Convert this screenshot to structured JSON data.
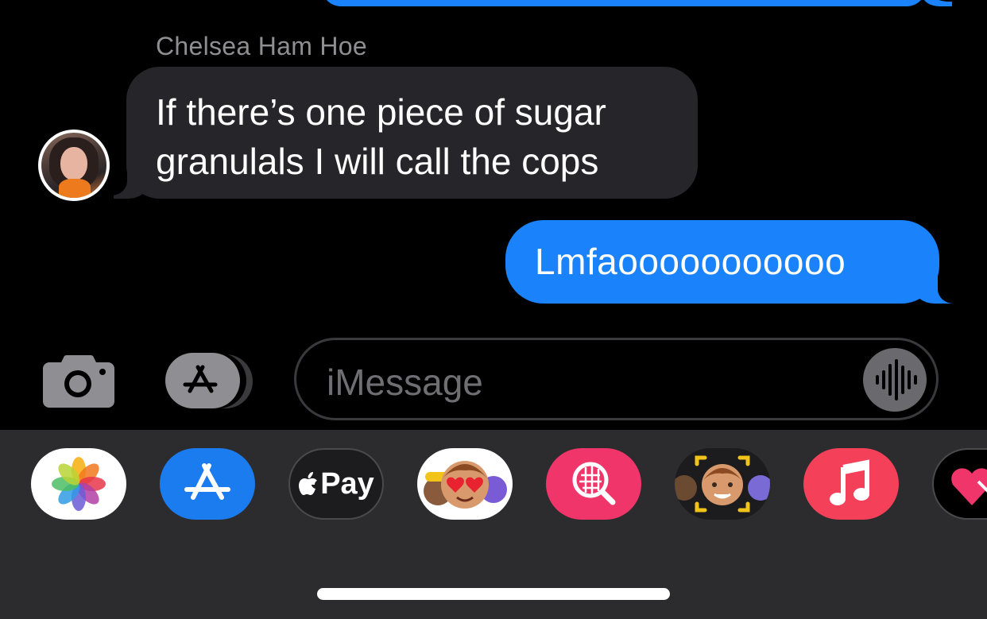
{
  "conversation": {
    "sender_name": "Chelsea Ham Hoe",
    "incoming_message": {
      "line1": "If there’s one piece of sugar",
      "line2": "granulals I will call the cops"
    },
    "outgoing_message": "Lmfaooooooooooo"
  },
  "composer": {
    "placeholder": "iMessage",
    "camera_icon": "camera-icon",
    "apps_icon": "app-store-icon",
    "audio_icon": "audio-waveform-icon"
  },
  "app_drawer": {
    "apps": [
      {
        "name": "Photos",
        "icon": "photos-icon"
      },
      {
        "name": "App Store",
        "icon": "app-store-icon"
      },
      {
        "name": "Apple Pay",
        "label": "Pay",
        "icon": "apple-logo-icon"
      },
      {
        "name": "Memoji",
        "icon": "memoji-icon"
      },
      {
        "name": "Images",
        "icon": "image-search-icon"
      },
      {
        "name": "Memoji Stickers",
        "icon": "memoji-sticker-icon"
      },
      {
        "name": "Music",
        "icon": "music-note-icon"
      },
      {
        "name": "Digital Touch",
        "icon": "heart-icon"
      }
    ]
  },
  "colors": {
    "outgoing_bubble": "#1a82fb",
    "incoming_bubble": "#26252a",
    "background": "#000000",
    "drawer": "#2c2c2e"
  }
}
